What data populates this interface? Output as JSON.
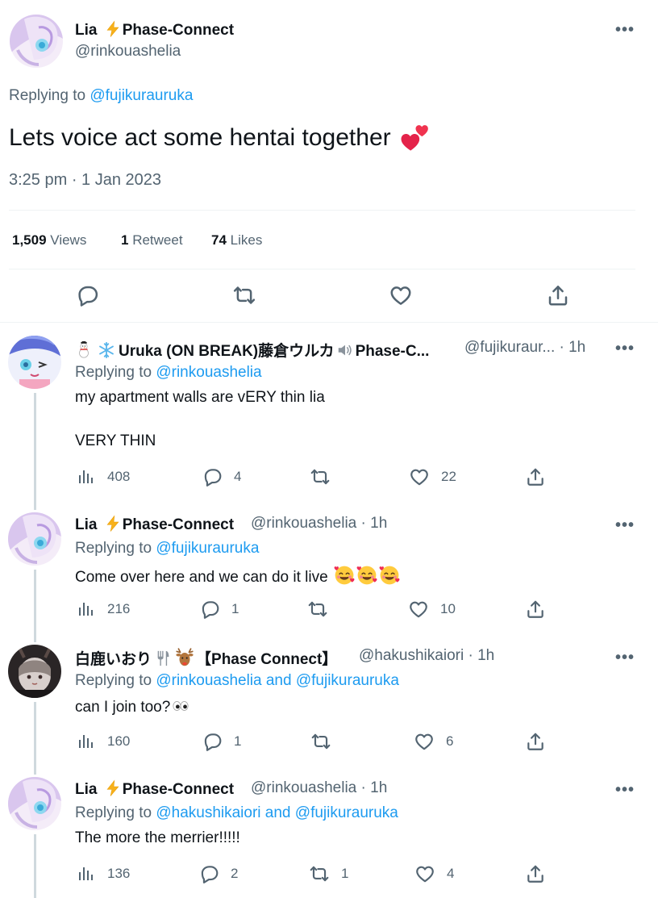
{
  "colors": {
    "link": "#1d9bf0",
    "text": "#0f1419",
    "secondary": "#536471",
    "border": "#eff3f4",
    "thread": "#cfd9de"
  },
  "main": {
    "author_name": "Lia",
    "author_name_suffix": "Phase-Connect",
    "author_handle": "@rinkouashelia",
    "replying_prefix": "Replying to",
    "replying_to": "@fujikurauruka",
    "text": "Lets voice act some hentai together",
    "timestamp": "3:25 pm · 1 Jan 2023",
    "stats": {
      "views_count": "1,509",
      "views_label": "Views",
      "retweets_count": "1",
      "retweets_label": "Retweet",
      "likes_count": "74",
      "likes_label": "Likes"
    }
  },
  "replies": [
    {
      "name": "Uruka (ON BREAK)藤倉ウルカ",
      "name_suffix": "Phase-C...",
      "handle": "@fujikuraur...",
      "time": "· 1h",
      "replying_prefix": "Replying to",
      "replying_to": "@rinkouashelia",
      "line1": "my apartment walls are vERY thin lia",
      "line2": "VERY THIN",
      "views": "408",
      "replies": "4",
      "retweets": "",
      "likes": "22"
    },
    {
      "name": "Lia",
      "name_suffix": "Phase-Connect",
      "handle": "@rinkouashelia",
      "time": "· 1h",
      "replying_prefix": "Replying to",
      "replying_to": "@fujikurauruka",
      "line1": "Come over here and we can do it live",
      "views": "216",
      "replies": "1",
      "retweets": "",
      "likes": "10"
    },
    {
      "name": "白鹿いおり",
      "name_suffix": "【Phase Connect】",
      "handle": "@hakushikaiori",
      "time": "· 1h",
      "replying_prefix": "Replying to",
      "replying_to": "@rinkouashelia and @fujikurauruka",
      "line1": "can I join too?",
      "views": "160",
      "replies": "1",
      "retweets": "",
      "likes": "6"
    },
    {
      "name": "Lia",
      "name_suffix": "Phase-Connect",
      "handle": "@rinkouashelia",
      "time": "· 1h",
      "replying_prefix": "Replying to",
      "replying_to": "@hakushikaiori and @fujikurauruka",
      "line1": "The more the merrier!!!!!",
      "views": "136",
      "replies": "2",
      "retweets": "1",
      "likes": "4"
    }
  ],
  "more_label": "•••"
}
